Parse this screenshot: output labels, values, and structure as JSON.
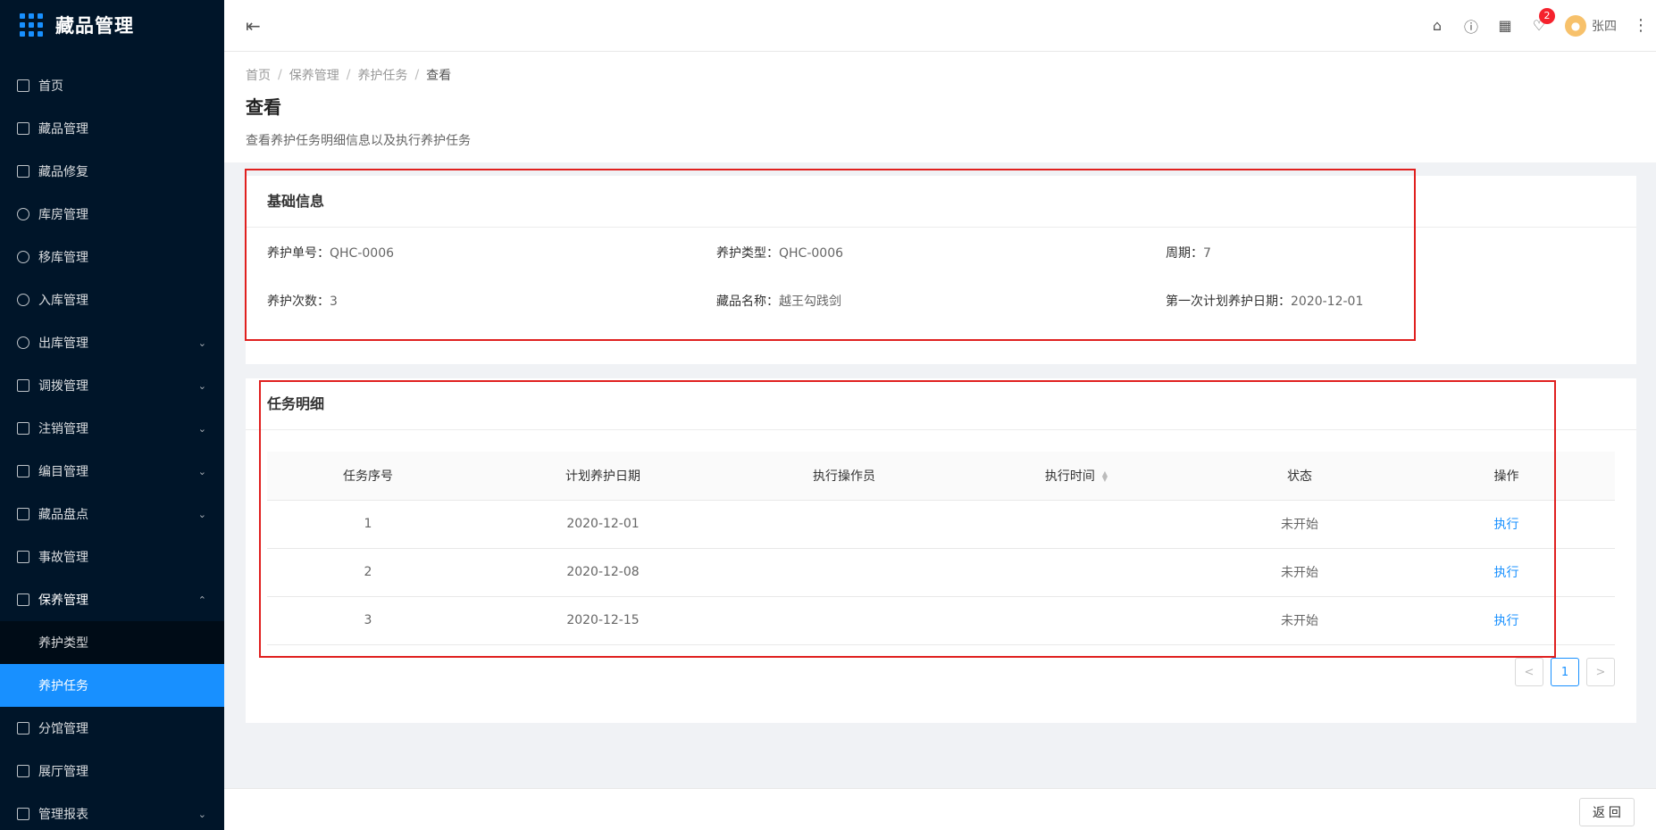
{
  "app": {
    "title": "藏品管理"
  },
  "sidebar": {
    "items": [
      {
        "label": "首页",
        "icon": "home-icon",
        "has_children": false
      },
      {
        "label": "藏品管理",
        "icon": "calendar-icon",
        "has_children": false
      },
      {
        "label": "藏品修复",
        "icon": "wrench-icon",
        "has_children": false
      },
      {
        "label": "库房管理",
        "icon": "warehouse-icon",
        "has_children": false
      },
      {
        "label": "移库管理",
        "icon": "move-icon",
        "has_children": false
      },
      {
        "label": "入库管理",
        "icon": "upload-cloud-icon",
        "has_children": false
      },
      {
        "label": "出库管理",
        "icon": "download-cloud-icon",
        "has_children": true
      },
      {
        "label": "调拨管理",
        "icon": "transfer-icon",
        "has_children": true
      },
      {
        "label": "注销管理",
        "icon": "file-icon",
        "has_children": true
      },
      {
        "label": "编目管理",
        "icon": "catalog-icon",
        "has_children": true
      },
      {
        "label": "藏品盘点",
        "icon": "inventory-icon",
        "has_children": true
      },
      {
        "label": "事故管理",
        "icon": "accident-icon",
        "has_children": false
      },
      {
        "label": "保养管理",
        "icon": "maintenance-icon",
        "has_children": true,
        "open": true
      },
      {
        "label": "分馆管理",
        "icon": "branch-icon",
        "has_children": false
      },
      {
        "label": "展厅管理",
        "icon": "monitor-icon",
        "has_children": false
      },
      {
        "label": "管理报表",
        "icon": "report-icon",
        "has_children": true
      }
    ],
    "submenu": [
      {
        "label": "养护类型",
        "active": false
      },
      {
        "label": "养护任务",
        "active": true
      }
    ]
  },
  "header": {
    "notification_count": "2",
    "username": "张四"
  },
  "breadcrumb": {
    "items": [
      "首页",
      "保养管理",
      "养护任务"
    ],
    "current": "查看"
  },
  "page": {
    "title": "查看",
    "description": "查看养护任务明细信息以及执行养护任务"
  },
  "basic_info": {
    "title": "基础信息",
    "fields": [
      {
        "label": "养护单号：",
        "value": "QHC-0006"
      },
      {
        "label": "养护类型：",
        "value": "QHC-0006"
      },
      {
        "label": "周期：",
        "value": "7"
      },
      {
        "label": "养护次数：",
        "value": "3"
      },
      {
        "label": "藏品名称：",
        "value": "越王勾践剑"
      },
      {
        "label": "第一次计划养护日期：",
        "value": "2020-12-01"
      }
    ]
  },
  "task_detail": {
    "title": "任务明细",
    "columns": [
      "任务序号",
      "计划养护日期",
      "执行操作员",
      "执行时间",
      "状态",
      "操作"
    ],
    "rows": [
      {
        "seq": "1",
        "date": "2020-12-01",
        "operator": "",
        "exec_time": "",
        "status": "未开始",
        "action": "执行"
      },
      {
        "seq": "2",
        "date": "2020-12-08",
        "operator": "",
        "exec_time": "",
        "status": "未开始",
        "action": "执行"
      },
      {
        "seq": "3",
        "date": "2020-12-15",
        "operator": "",
        "exec_time": "",
        "status": "未开始",
        "action": "执行"
      }
    ]
  },
  "pagination": {
    "prev": "<",
    "current": "1",
    "next": ">"
  },
  "footer": {
    "back_label": "返 回"
  },
  "colors": {
    "accent": "#1890ff",
    "sidebar_bg": "#001529",
    "highlight": "#e0201f",
    "badge": "#f5222d"
  }
}
